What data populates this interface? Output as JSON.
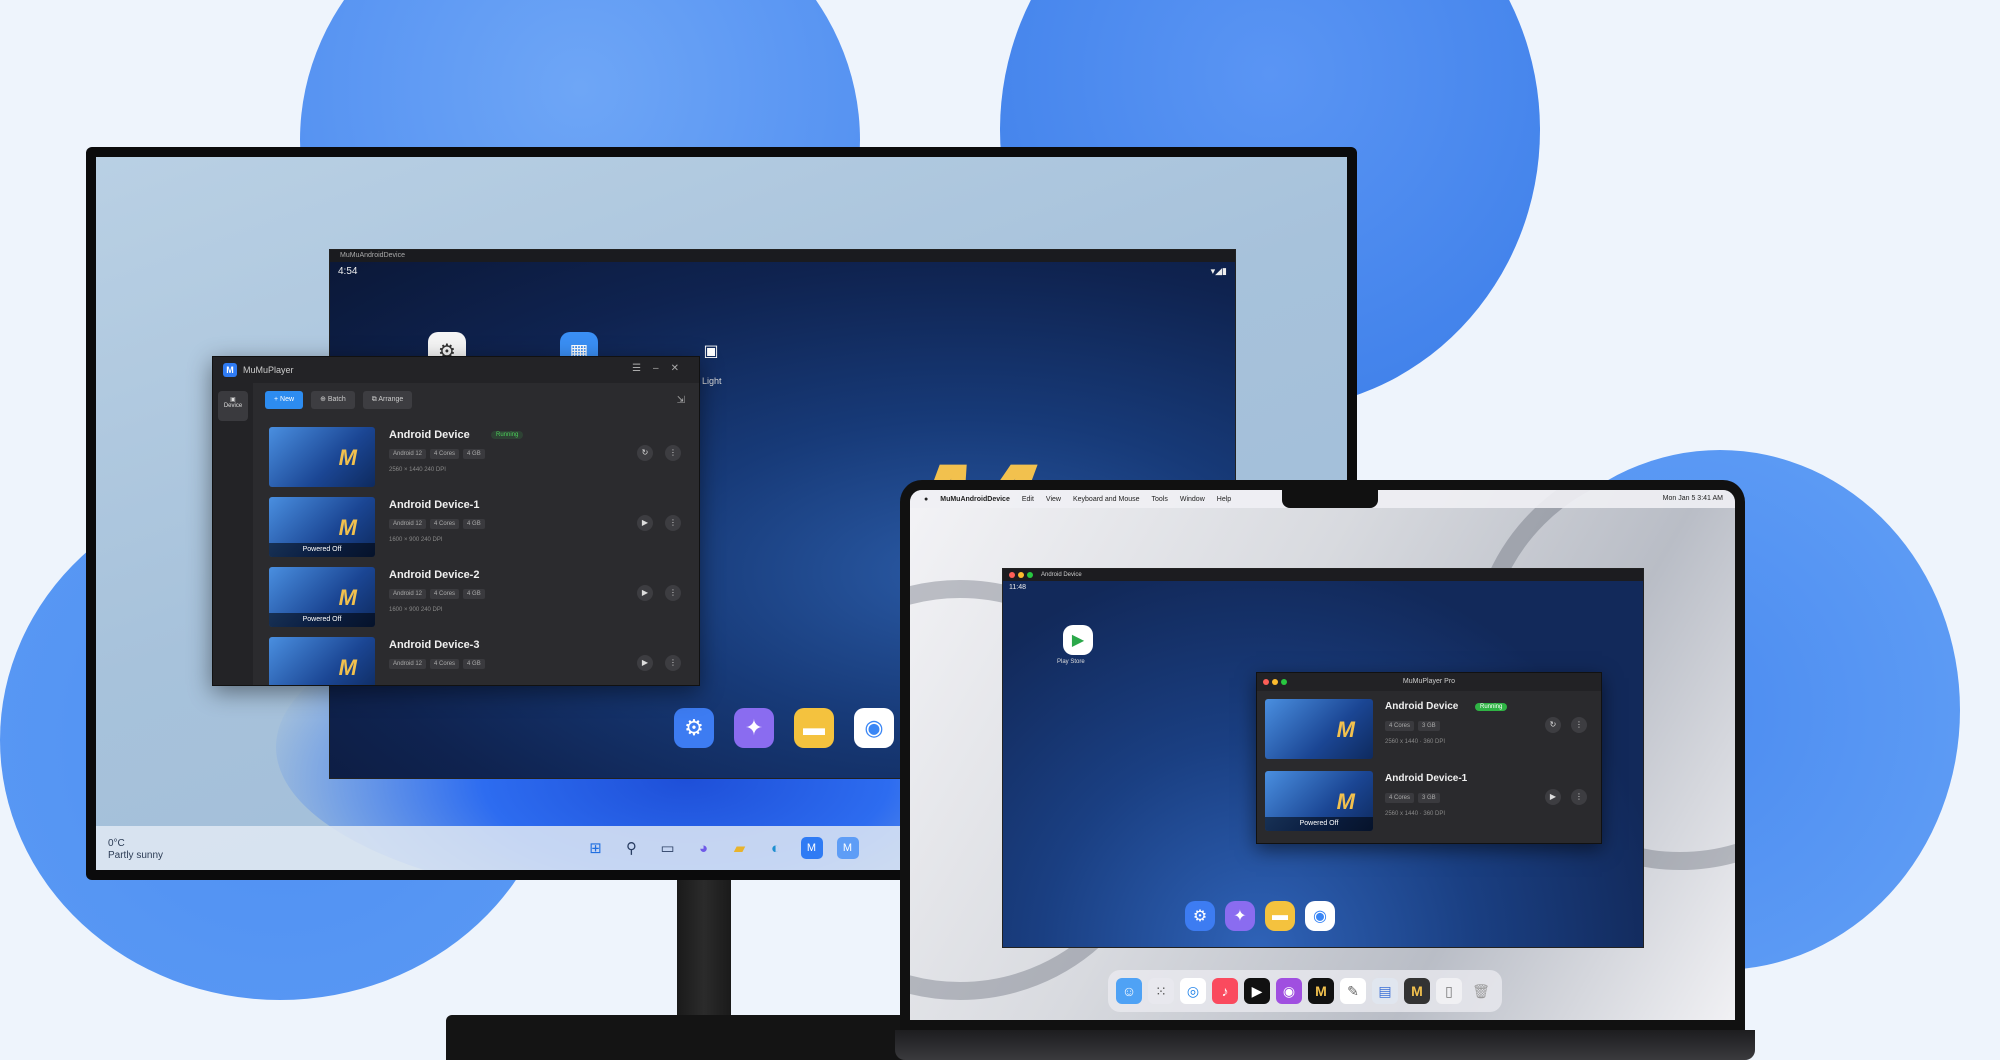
{
  "windows_monitor": {
    "android_window": {
      "title": "MuMuAndroidDevice",
      "time": "4:54",
      "status": "▾◢▮",
      "app_label": "Light"
    },
    "manager": {
      "title": "MuMuPlayer",
      "sidebar_tab": "Device",
      "toolbar": {
        "new": "New",
        "batch": "Batch",
        "arrange": "Arrange"
      },
      "devices": [
        {
          "name": "Android Device",
          "status": "Running",
          "tags": [
            "Android 12",
            "4 Cores",
            "4 GB"
          ],
          "spec": "2560 × 1440  240 DPI",
          "power_off": ""
        },
        {
          "name": "Android Device-1",
          "status": "",
          "tags": [
            "Android 12",
            "4 Cores",
            "4 GB"
          ],
          "spec": "1600 × 900  240 DPI",
          "power_off": "Powered Off"
        },
        {
          "name": "Android Device-2",
          "status": "",
          "tags": [
            "Android 12",
            "4 Cores",
            "4 GB"
          ],
          "spec": "1600 × 900  240 DPI",
          "power_off": "Powered Off"
        },
        {
          "name": "Android Device-3",
          "status": "",
          "tags": [
            "Android 12",
            "4 Cores",
            "4 GB"
          ],
          "spec": "",
          "power_off": ""
        }
      ]
    },
    "taskbar": {
      "weather_temp": "0°C",
      "weather_desc": "Partly sunny"
    }
  },
  "mac_laptop": {
    "menubar": {
      "items": [
        "MuMuAndroidDevice",
        "Edit",
        "View",
        "Keyboard and Mouse",
        "Tools",
        "Window",
        "Help"
      ],
      "clock": "Mon Jan 5  3:41 AM"
    },
    "android_window": {
      "title": "Android Device",
      "time": "11:48",
      "app_label": "Play Store"
    },
    "manager": {
      "title": "MuMuPlayer Pro",
      "devices": [
        {
          "name": "Android Device",
          "status": "Running",
          "tags": [
            "4 Cores",
            "3 GB"
          ],
          "spec": "2560 x 1440 · 360 DPI",
          "power_off": ""
        },
        {
          "name": "Android Device-1",
          "status": "",
          "tags": [
            "4 Cores",
            "3 GB"
          ],
          "spec": "2560 x 1440 · 360 DPI",
          "power_off": "Powered Off"
        }
      ]
    }
  },
  "colors": {
    "accent": "#2d8cf0",
    "running": "#4ccf5a",
    "logo": "#f2c14e"
  }
}
